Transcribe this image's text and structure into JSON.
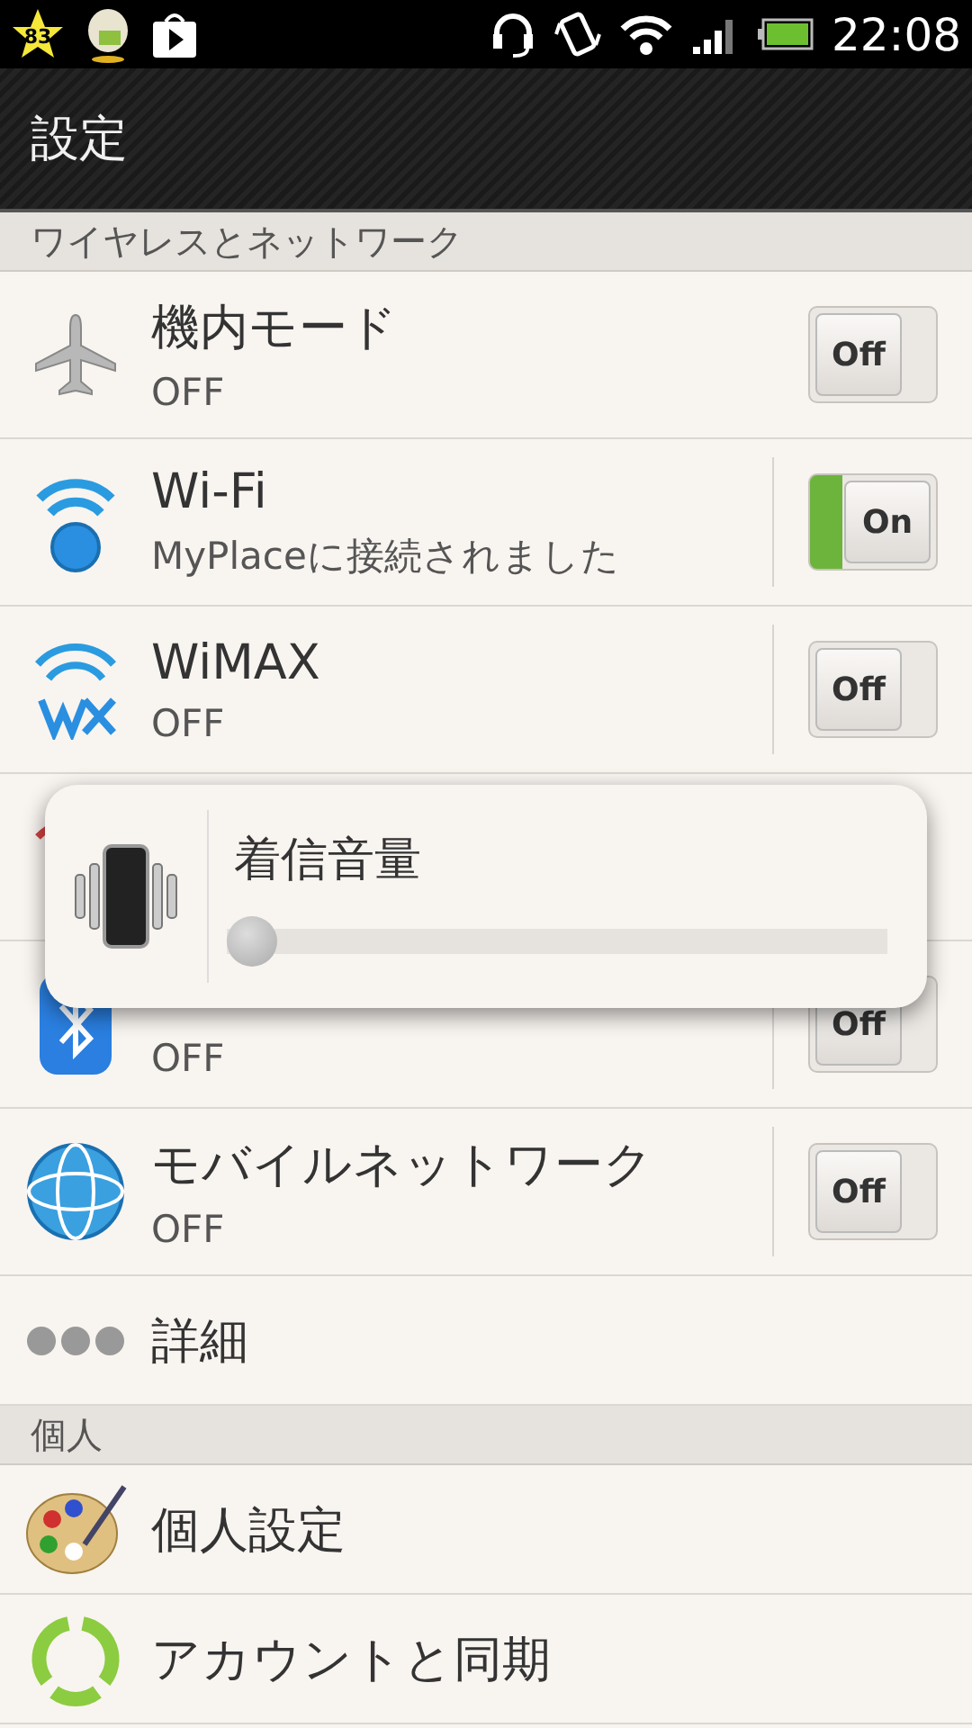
{
  "status_bar": {
    "notification_count": "83",
    "time": "22:08"
  },
  "title": "設定",
  "sections": [
    {
      "header": "ワイヤレスとネットワーク",
      "items": [
        {
          "kind": "toggle",
          "title": "機内モード",
          "subtitle": "OFF",
          "switch": {
            "on": false,
            "label": "Off"
          }
        },
        {
          "kind": "split-toggle",
          "title": "Wi-Fi",
          "subtitle": "MyPlaceに接続されました",
          "switch": {
            "on": true,
            "label": "On"
          }
        },
        {
          "kind": "split-toggle",
          "title": "WiMAX",
          "subtitle": "OFF",
          "switch": {
            "on": false,
            "label": "Off"
          }
        },
        {
          "kind": "covered"
        },
        {
          "kind": "split-toggle",
          "subtitle": "OFF",
          "switch": {
            "on": false,
            "label": "Off"
          }
        },
        {
          "kind": "split-toggle",
          "title": "モバイルネットワーク",
          "subtitle": "OFF",
          "switch": {
            "on": false,
            "label": "Off"
          }
        },
        {
          "kind": "plain",
          "title": "詳細"
        }
      ]
    },
    {
      "header": "個人",
      "items": [
        {
          "kind": "plain",
          "title": "個人設定"
        },
        {
          "kind": "plain",
          "title": "アカウントと同期"
        }
      ]
    }
  ],
  "volume_dialog": {
    "title": "着信音量",
    "level": 0.0
  }
}
